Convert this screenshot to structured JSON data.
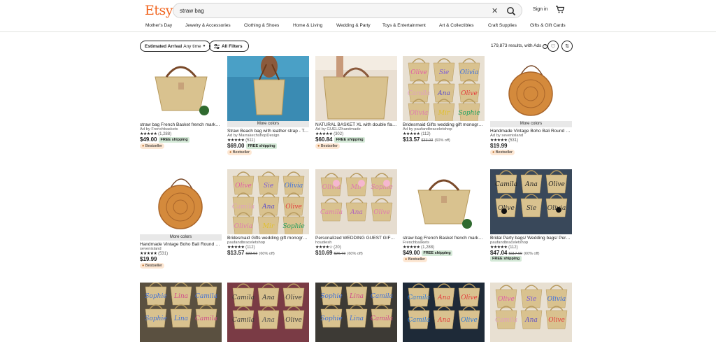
{
  "header": {
    "logo": "Etsy",
    "search_value": "straw bag",
    "signin": "Sign in",
    "nav": [
      "Mother's Day",
      "Jewelry & Accessories",
      "Clothing & Shoes",
      "Home & Living",
      "Wedding & Party",
      "Toys & Entertainment",
      "Art & Collectibles",
      "Craft Supplies",
      "Gifts & Gift Cards"
    ]
  },
  "filters": {
    "arrival_label": "Estimated Arrival",
    "arrival_value": "Any time",
    "all_filters": "All Filters",
    "results": "179,873 results, with Ads"
  },
  "colors": {
    "brand": "#f1641e",
    "free_shipping": "#d4e9d7",
    "bestseller": "#fde7d3"
  },
  "products": [
    {
      "title": "straw bag French Basket french market bag",
      "more_colors": "",
      "shop": "Ad by Frenchbaskets",
      "stars": "★★★★★",
      "count": "(1,288)",
      "price": "$49.00",
      "orig": "",
      "off": "",
      "free": "FREE shipping",
      "best": "Bestseller",
      "img": "basket"
    },
    {
      "title": "Straw Beach bag with leather strap - Tote bag",
      "more_colors": "More colors",
      "shop": "Ad by MarrakechshopDesign",
      "stars": "★★★★★",
      "count": "(511)",
      "price": "$69.00",
      "orig": "",
      "off": "",
      "free": "FREE shipping",
      "best": "Bestseller",
      "img": "beach"
    },
    {
      "title": "NATURAL BASKET XL with double flat handles",
      "more_colors": "",
      "shop": "Ad by GUELIZhandmade",
      "stars": "★★★★★",
      "count": "(302)",
      "price": "$60.84",
      "orig": "",
      "off": "",
      "free": "FREE shipping",
      "best": "Bestseller",
      "img": "tote"
    },
    {
      "title": "Bridesmaid Gifts wedding gift monogram bag",
      "more_colors": "",
      "shop": "Ad by paufandbraceletshop",
      "stars": "★★★★★",
      "count": "(112)",
      "price": "$13.57",
      "orig": "$33.93",
      "off": "(60% off)",
      "free": "",
      "best": "",
      "img": "names"
    },
    {
      "title": "Handmade Vintage Boho Bali Round Rattan Bag",
      "more_colors": "More colors",
      "shop": "Ad by sevenisland",
      "stars": "★★★★★",
      "count": "(531)",
      "price": "$19.99",
      "orig": "",
      "off": "",
      "free": "",
      "best": "Bestseller",
      "img": "round"
    },
    {
      "title": "Handmade Vintage Boho Bali Round Rattan Bag",
      "more_colors": "More colors",
      "shop": "sevenisland",
      "stars": "★★★★★",
      "count": "(531)",
      "price": "$19.99",
      "orig": "",
      "off": "",
      "free": "",
      "best": "Bestseller",
      "img": "round"
    },
    {
      "title": "Bridesmaid Gifts wedding gift monogram bag",
      "more_colors": "",
      "shop": "paufandbraceletshop",
      "stars": "★★★★★",
      "count": "(112)",
      "price": "$13.57",
      "orig": "$33.93",
      "off": "(60% off)",
      "free": "",
      "best": "",
      "img": "names"
    },
    {
      "title": "Personalized WEDDING GUEST GIFT Bags",
      "more_colors": "",
      "shop": "houdiesh",
      "stars": "★★★★☆",
      "count": "(20)",
      "price": "$10.69",
      "orig": "$26.73",
      "off": "(60% off)",
      "free": "",
      "best": "",
      "img": "pompom"
    },
    {
      "title": "straw bag French Basket french market bag",
      "more_colors": "",
      "shop": "Frenchbaskets",
      "stars": "★★★★★",
      "count": "(1,288)",
      "price": "$49.00",
      "orig": "",
      "off": "",
      "free": "FREE shipping",
      "best": "Bestseller",
      "img": "basket"
    },
    {
      "title": "Bridal Party bags/ Wedding bags/ Personalized",
      "more_colors": "",
      "shop": "paufandbraceletshop",
      "stars": "★★★★★",
      "count": "(112)",
      "price": "$47.04",
      "orig": "$117.60",
      "off": "(60% off)",
      "free": "FREE shipping",
      "best": "",
      "img": "bridal"
    },
    {
      "img": "row3a"
    },
    {
      "img": "row3b"
    },
    {
      "img": "row3c"
    },
    {
      "img": "row3d"
    },
    {
      "img": "row3e"
    }
  ]
}
